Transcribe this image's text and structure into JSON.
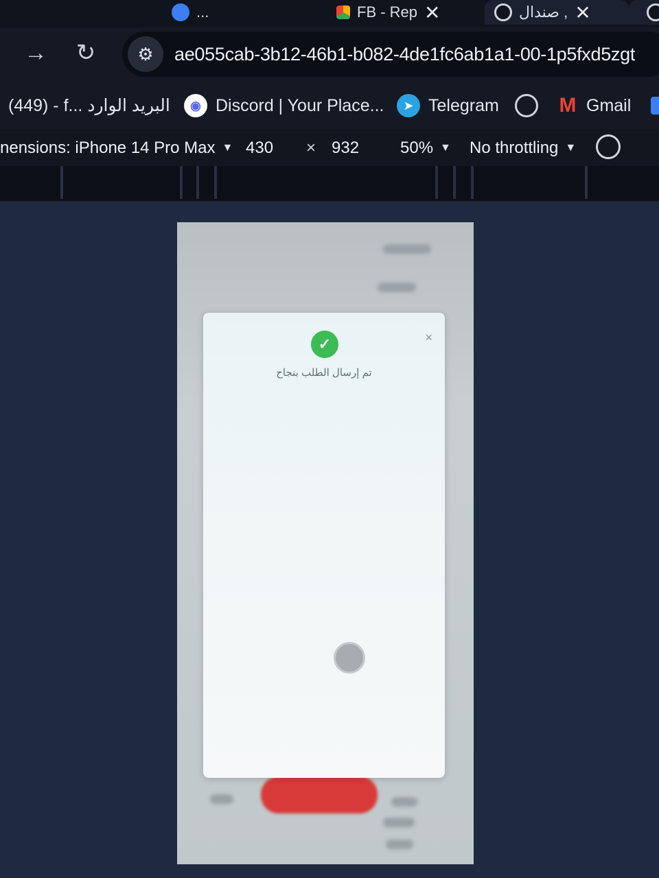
{
  "tabs": [
    {
      "label": "...",
      "icon": "globe-icon"
    },
    {
      "label": "FB - Rep",
      "icon": "multicolor-app-icon"
    },
    {
      "label": "صندال ,",
      "icon": "globe-icon",
      "close": "✕"
    },
    {
      "label": "",
      "icon": "globe-icon"
    }
  ],
  "toolbar": {
    "url": "ae055cab-3b12-46b1-b082-4de1fc6ab1a1-00-1p5fxd5zgt"
  },
  "bookmarks": [
    {
      "label": "(449) - f... البريد الوارد",
      "icon": ""
    },
    {
      "label": "Discord | Your Place...",
      "icon": "discord-icon"
    },
    {
      "label": "Telegram",
      "icon": "telegram-icon"
    },
    {
      "label": "",
      "icon": "globe-icon"
    },
    {
      "label": "Gmail",
      "icon": "gmail-icon"
    }
  ],
  "device_toolbar": {
    "dimensions_label": "nensions: iPhone 14 Pro Max",
    "width": "430",
    "times": "×",
    "height": "932",
    "zoom": "50%",
    "throttling": "No throttling"
  },
  "modal": {
    "message": "تم إرسال الطلب بنجاح",
    "close": "×",
    "success_color": "#3dbb55"
  }
}
